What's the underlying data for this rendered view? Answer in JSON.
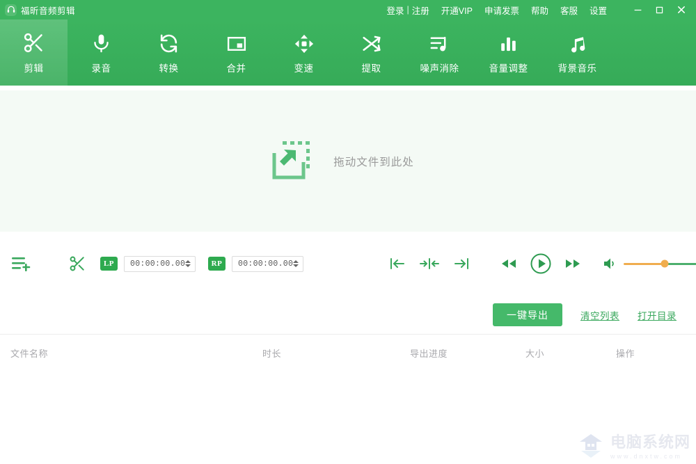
{
  "window": {
    "app_title": "福昕音频剪辑",
    "logo_icon": "headphones-icon",
    "menu": {
      "login": "登录",
      "separator": "|",
      "register": "注册",
      "vip": "开通VIP",
      "invoice": "申请发票",
      "help": "帮助",
      "support": "客服",
      "settings": "设置"
    },
    "controls": {
      "minimize": "minimize-icon",
      "maximize": "maximize-icon",
      "close": "close-icon"
    }
  },
  "toolbar": {
    "active_index": 0,
    "items": [
      {
        "label": "剪辑",
        "icon": "scissors-icon"
      },
      {
        "label": "录音",
        "icon": "microphone-icon"
      },
      {
        "label": "转换",
        "icon": "convert-refresh-icon"
      },
      {
        "label": "合并",
        "icon": "merge-box-icon"
      },
      {
        "label": "变速",
        "icon": "speed-arrows-icon"
      },
      {
        "label": "提取",
        "icon": "shuffle-extract-icon"
      },
      {
        "label": "噪声消除",
        "icon": "noise-list-note-icon"
      },
      {
        "label": "音量调整",
        "icon": "volume-bars-icon"
      },
      {
        "label": "背景音乐",
        "icon": "music-note-icon"
      }
    ]
  },
  "dropzone": {
    "icon": "drag-drop-file-icon",
    "text": "拖动文件到此处"
  },
  "controls_bar": {
    "add_list_icon": "add-to-list-icon",
    "cut_icon": "scissors-icon",
    "left_point": {
      "tag": "LP",
      "value": "00:00:00.00",
      "spinner_icon": "spinner-arrows-icon"
    },
    "right_point": {
      "tag": "RP",
      "value": "00:00:00.00",
      "spinner_icon": "spinner-arrows-icon"
    },
    "mark_start_icon": "mark-start-icon",
    "mark_split_icon": "mark-split-icon",
    "mark_end_icon": "mark-end-icon",
    "rewind_icon": "rewind-icon",
    "play_icon": "play-circle-icon",
    "forward_icon": "fast-forward-icon",
    "volume_icon": "volume-speaker-icon",
    "volume_slider": {
      "value": 55,
      "filled_color": "#f0ad4e",
      "remaining_color": "#4caf6d",
      "thumb_color": "#f0ad4e"
    }
  },
  "actions": {
    "export_label": "一键导出",
    "clear_list_label": "清空列表",
    "open_folder_label": "打开目录"
  },
  "file_table": {
    "columns": [
      "文件名称",
      "时长",
      "导出进度",
      "大小",
      "操作"
    ],
    "rows": []
  },
  "watermark": {
    "logo_icon": "house-shield-icon",
    "title": "电脑系统网",
    "url": "www.dnxtw.com"
  },
  "colors": {
    "brand_green": "#3cb45f",
    "button_green": "#45b96a",
    "link_green": "#3aa85d",
    "dropzone_bg": "#f4faf5",
    "accent_orange": "#f0ad4e"
  }
}
